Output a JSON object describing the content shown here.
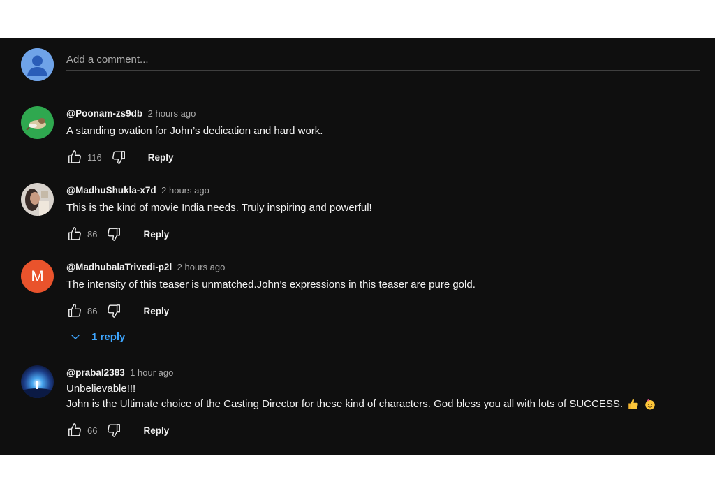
{
  "add_comment": {
    "placeholder": "Add a comment..."
  },
  "comments": [
    {
      "handle": "@Poonam-zs9db",
      "time": "2 hours ago",
      "text": "A standing ovation for John’s dedication and hard work.",
      "likes": "116",
      "reply_label": "Reply"
    },
    {
      "handle": "@MadhuShukla-x7d",
      "time": "2 hours ago",
      "text": "This is the kind of movie India needs. Truly inspiring and powerful!",
      "likes": "86",
      "reply_label": "Reply"
    },
    {
      "handle": "@MadhubalaTrivedi-p2l",
      "time": "2 hours ago",
      "text": "The intensity of this teaser is unmatched.John’s expressions in this teaser are pure gold.",
      "likes": "86",
      "reply_label": "Reply",
      "avatar_letter": "M",
      "replies_label": "1 reply"
    },
    {
      "handle": "@prabal2383",
      "time": "1 hour ago",
      "text_line1": "Unbelievable!!!",
      "text_line2": "John is the Ultimate choice of the Casting Director for these kind of characters. God bless you all with lots of SUCCESS.",
      "likes": "66",
      "reply_label": "Reply"
    }
  ],
  "colors": {
    "background": "#0f0f0f",
    "text": "#f1f1f1",
    "secondary_text": "#aaaaaa",
    "link_blue": "#3ea6ff",
    "avatar_orange": "#e9532c"
  },
  "icons": [
    "user-avatar-icon",
    "thumbs-up-icon",
    "thumbs-down-icon",
    "chevron-down-icon",
    "thumbs-up-emoji",
    "face-emoji"
  ]
}
